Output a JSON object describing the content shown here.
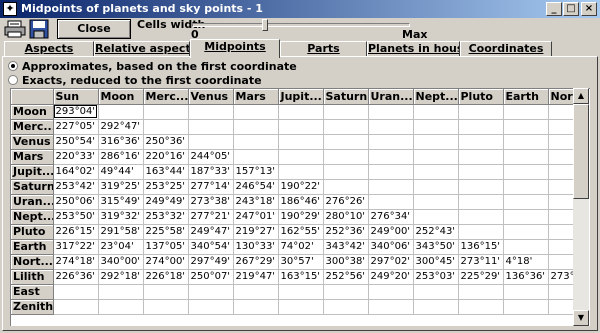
{
  "window": {
    "title": "Midpoints of planets and sky points - 1",
    "controls": {
      "minimize": "_",
      "maximize": "□",
      "close": "×"
    }
  },
  "toolbar": {
    "close_label": "Close",
    "cells_width_label": "Cells width",
    "slider_min": "0",
    "slider_max": "Max",
    "icons": [
      "print-icon",
      "save-icon"
    ]
  },
  "tabs": [
    {
      "label": "Aspects",
      "active": false
    },
    {
      "label": "Relative aspects",
      "active": false
    },
    {
      "label": "Midpoints",
      "active": true
    },
    {
      "label": "Parts",
      "active": false
    },
    {
      "label": "Planets in houses",
      "active": false
    },
    {
      "label": "Coordinates",
      "active": false
    }
  ],
  "options": {
    "approx_label": "Approximates, based on the first coordinate",
    "exact_label": "Exacts, reduced to the first coordinate",
    "selected": "approx"
  },
  "grid": {
    "columns": [
      "Sun",
      "Moon",
      "Merc...",
      "Venus",
      "Mars",
      "Jupit...",
      "Saturn",
      "Uran...",
      "Nept...",
      "Pluto",
      "Earth",
      "Nort..."
    ],
    "rows": [
      {
        "label": "Moon",
        "cells": [
          "293°04'",
          "",
          "",
          "",
          "",
          "",
          "",
          "",
          "",
          "",
          "",
          ""
        ]
      },
      {
        "label": "Merc...",
        "cells": [
          "227°05'",
          "292°47'",
          "",
          "",
          "",
          "",
          "",
          "",
          "",
          "",
          "",
          ""
        ]
      },
      {
        "label": "Venus",
        "cells": [
          "250°54'",
          "316°36'",
          "250°36'",
          "",
          "",
          "",
          "",
          "",
          "",
          "",
          "",
          ""
        ]
      },
      {
        "label": "Mars",
        "cells": [
          "220°33'",
          "286°16'",
          "220°16'",
          "244°05'",
          "",
          "",
          "",
          "",
          "",
          "",
          "",
          ""
        ]
      },
      {
        "label": "Jupit...",
        "cells": [
          "164°02'",
          "49°44'",
          "163°44'",
          "187°33'",
          "157°13'",
          "",
          "",
          "",
          "",
          "",
          "",
          ""
        ]
      },
      {
        "label": "Saturn",
        "cells": [
          "253°42'",
          "319°25'",
          "253°25'",
          "277°14'",
          "246°54'",
          "190°22'",
          "",
          "",
          "",
          "",
          "",
          ""
        ]
      },
      {
        "label": "Uran...",
        "cells": [
          "250°06'",
          "315°49'",
          "249°49'",
          "273°38'",
          "243°18'",
          "186°46'",
          "276°26'",
          "",
          "",
          "",
          "",
          ""
        ]
      },
      {
        "label": "Nept...",
        "cells": [
          "253°50'",
          "319°32'",
          "253°32'",
          "277°21'",
          "247°01'",
          "190°29'",
          "280°10'",
          "276°34'",
          "",
          "",
          "",
          ""
        ]
      },
      {
        "label": "Pluto",
        "cells": [
          "226°15'",
          "291°58'",
          "225°58'",
          "249°47'",
          "219°27'",
          "162°55'",
          "252°36'",
          "249°00'",
          "252°43'",
          "",
          "",
          ""
        ]
      },
      {
        "label": "Earth",
        "cells": [
          "317°22'",
          "23°04'",
          "137°05'",
          "340°54'",
          "130°33'",
          "74°02'",
          "343°42'",
          "340°06'",
          "343°50'",
          "136°15'",
          "",
          ""
        ]
      },
      {
        "label": "Nort...",
        "cells": [
          "274°18'",
          "340°00'",
          "274°00'",
          "297°49'",
          "267°29'",
          "30°57'",
          "300°38'",
          "297°02'",
          "300°45'",
          "273°11'",
          "4°18'",
          ""
        ]
      },
      {
        "label": "Lilith",
        "cells": [
          "226°36'",
          "292°18'",
          "226°18'",
          "250°07'",
          "219°47'",
          "163°15'",
          "252°56'",
          "249°20'",
          "253°03'",
          "225°29'",
          "136°36'",
          "273°31'"
        ]
      },
      {
        "label": "East",
        "cells": [
          "",
          "",
          "",
          "",
          "",
          "",
          "",
          "",
          "",
          "",
          "",
          ""
        ]
      },
      {
        "label": "Zenith",
        "cells": [
          "",
          "",
          "",
          "",
          "",
          "",
          "",
          "",
          "",
          "",
          "",
          ""
        ]
      }
    ]
  }
}
